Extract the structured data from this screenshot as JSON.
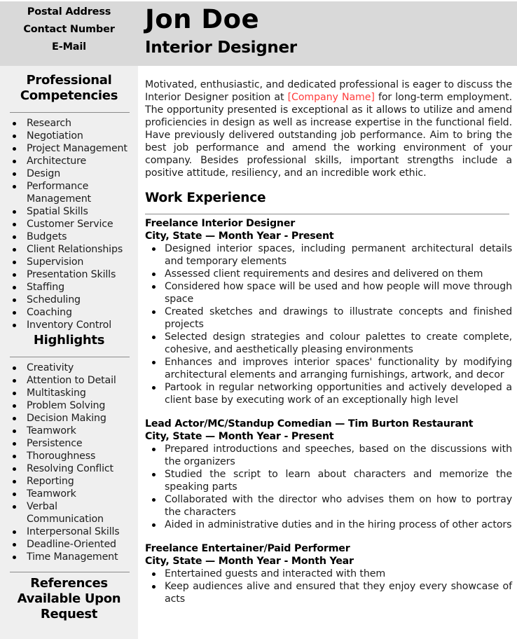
{
  "header": {
    "contact": [
      "Postal Address",
      "Contact Number",
      "E-Mail"
    ],
    "name": "Jon Doe",
    "role": "Interior Designer"
  },
  "sidebar": {
    "competencies_title_line1": "Professional",
    "competencies_title_line2": "Competencies",
    "competencies": [
      "Research",
      "Negotiation",
      "Project Management",
      "Architecture",
      "Design",
      "Performance Management",
      "Spatial Skills",
      "Customer Service",
      "Budgets",
      "Client Relationships",
      "Supervision",
      "Presentation Skills",
      "Staffing",
      "Scheduling",
      "Coaching",
      "Inventory Control"
    ],
    "highlights_title": "Highlights",
    "highlights": [
      "Creativity",
      "Attention to Detail",
      "Multitasking",
      "Problem Solving",
      "Decision Making",
      "Teamwork",
      "Persistence",
      "Thoroughness",
      "Resolving Conflict",
      "Reporting",
      "Teamwork",
      "Verbal Communication",
      "Interpersonal Skills",
      "Deadline-Oriented",
      "Time Management"
    ],
    "references_line1": "References",
    "references_line2": "Available Upon",
    "references_line3": "Request"
  },
  "summary": {
    "before": "Motivated, enthusiastic, and dedicated professional is eager to discuss the Interior Designer position at ",
    "company_placeholder": "[Company Name]",
    "after": " for long-term employment. The opportunity presented is exceptional as it allows to utilize and amend proficiencies in design as well as increase expertise in the functional field. Have previously delivered outstanding job performance. Aim to bring the best job performance and amend the working environment of your company. Besides professional skills, important strengths include a positive attitude, resiliency, and an incredible work ethic.",
    "placeholder_color": "#ff3b3b"
  },
  "work": {
    "title": "Work Experience",
    "jobs": [
      {
        "title": "Freelance Interior Designer",
        "meta": "City, State — Month Year - Present",
        "bullets": [
          "Designed interior spaces, including permanent architectural details and temporary elements",
          "Assessed client requirements and desires and delivered on them",
          "Considered how space will be used and how people will move through space",
          "Created sketches and drawings to illustrate concepts and finished projects",
          "Selected design strategies and colour palettes to create complete, cohesive, and aesthetically pleasing environments",
          "Enhances and improves interior spaces' functionality by modifying architectural elements and arranging furnishings, artwork, and decor",
          "Partook in regular networking opportunities and actively developed a client base by executing work of an exceptionally high level"
        ]
      },
      {
        "title": "Lead Actor/MC/Standup Comedian — Tim Burton Restaurant",
        "meta": "City, State — Month Year - Present",
        "bullets": [
          "Prepared introductions and speeches, based on the discussions with the organizers",
          "Studied the script to learn about characters and memorize the speaking parts",
          "Collaborated with the director who advises them on how to portray the characters",
          "Aided in administrative duties and in the hiring process of other actors"
        ]
      },
      {
        "title": "Freelance Entertainer/Paid Performer",
        "meta": "City, State — Month Year - Month Year",
        "bullets": [
          "Entertained guests and interacted with them",
          "Keep audiences alive and ensured that they enjoy every showcase of acts"
        ]
      }
    ]
  }
}
